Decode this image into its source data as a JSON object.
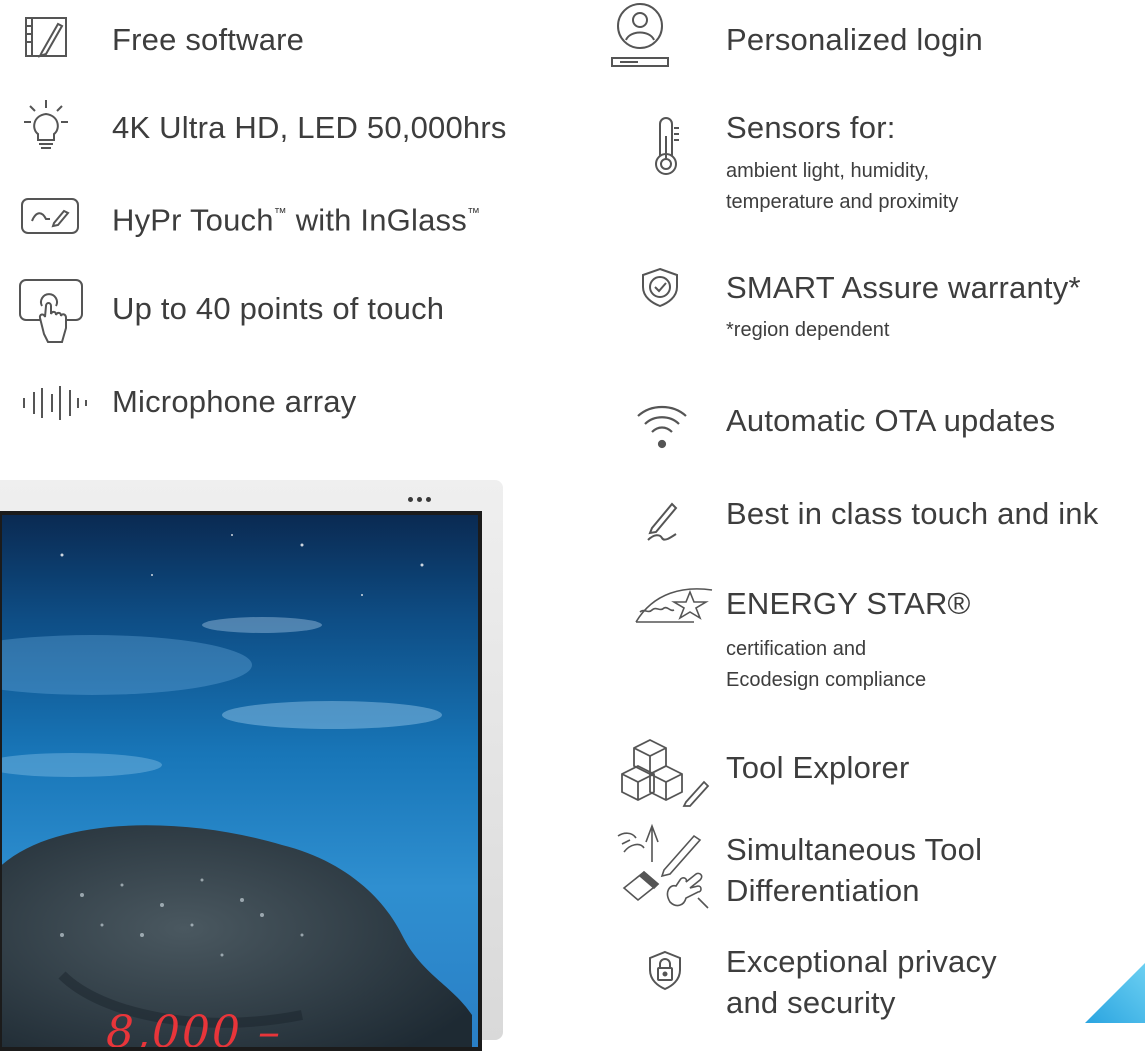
{
  "left_features": [
    {
      "icon": "whiteboard-pen-icon",
      "label": "Free software"
    },
    {
      "icon": "lightbulb-icon",
      "label": "4K Ultra HD, LED 50,000hrs"
    },
    {
      "icon": "touch-ink-icon",
      "label_main": "HyPr Touch",
      "label_mid": " with InGlass",
      "tm": "™"
    },
    {
      "icon": "touch-hand-icon",
      "label": "Up to 40 points of touch"
    },
    {
      "icon": "microphone-wave-icon",
      "label": "Microphone array"
    }
  ],
  "right_features": [
    {
      "icon": "user-login-icon",
      "label": "Personalized login"
    },
    {
      "icon": "thermometer-icon",
      "label": "Sensors for:",
      "sub": [
        "ambient light, humidity,",
        "temperature and proximity"
      ]
    },
    {
      "icon": "shield-check-icon",
      "label": "SMART Assure warranty*",
      "sub": [
        "*region dependent"
      ]
    },
    {
      "icon": "wifi-icon",
      "label": "Automatic OTA updates"
    },
    {
      "icon": "pen-ink-icon",
      "label": "Best in class touch and ink"
    },
    {
      "icon": "energy-star-icon",
      "label": "ENERGY STAR®",
      "sub": [
        "certification and",
        "Ecodesign compliance"
      ]
    },
    {
      "icon": "cubes-pen-icon",
      "label": "Tool Explorer"
    },
    {
      "icon": "multi-touch-tools-icon",
      "label": [
        "Simultaneous Tool",
        "Differentiation"
      ]
    },
    {
      "icon": "lock-shield-icon",
      "label": [
        "Exceptional privacy",
        "and security"
      ]
    }
  ],
  "display": {
    "screen_annotation": "8,000 –"
  },
  "colors": {
    "text": "#3d3d3d",
    "icon_stroke": "#555555",
    "annotation": "#e8353a",
    "accent": "#2aa4e0"
  }
}
